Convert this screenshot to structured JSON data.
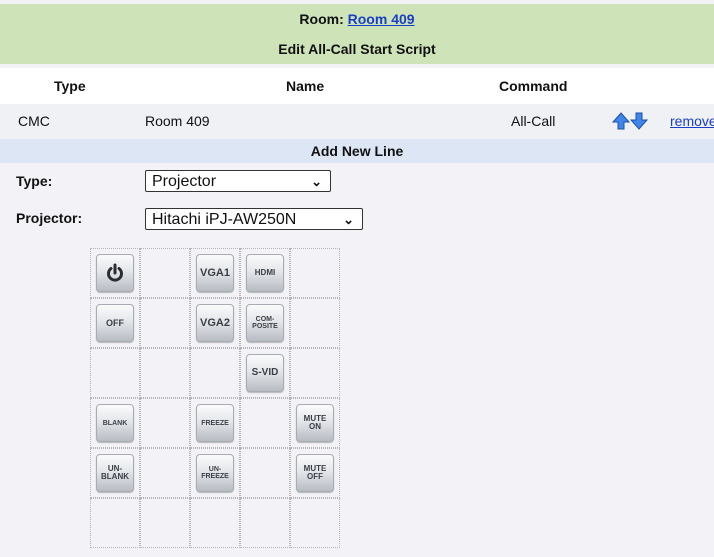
{
  "header": {
    "room_label": "Room:",
    "room_link": "Room 409",
    "script_title": "Edit All-Call Start Script"
  },
  "columns": {
    "type": "Type",
    "name": "Name",
    "command": "Command"
  },
  "script_rows": [
    {
      "type": "CMC",
      "name": "Room 409",
      "command": "All-Call",
      "remove_label": "remove"
    }
  ],
  "add_line": {
    "title": "Add New Line",
    "type_label": "Type:",
    "type_value": "Projector",
    "projector_label": "Projector:",
    "projector_value": "Hitachi iPJ-AW250N"
  },
  "projector_buttons": {
    "power": "power-icon",
    "off": "OFF",
    "vga1": "VGA1",
    "hdmi": "HDMI",
    "vga2": "VGA2",
    "composite_1": "COM-",
    "composite_2": "POSITE",
    "svid": "S-VID",
    "blank": "BLANK",
    "freeze": "FREEZE",
    "mute_on_1": "MUTE",
    "mute_on_2": "ON",
    "unblank_1": "UN-",
    "unblank_2": "BLANK",
    "unfreeze_1": "UN-",
    "unfreeze_2": "FREEZE",
    "mute_off_1": "MUTE",
    "mute_off_2": "OFF"
  },
  "colors": {
    "header_bg": "#cfe3b8",
    "link": "#1a3fc4",
    "add_line_bg": "#dde6f5",
    "arrow": "#3f86e8"
  }
}
